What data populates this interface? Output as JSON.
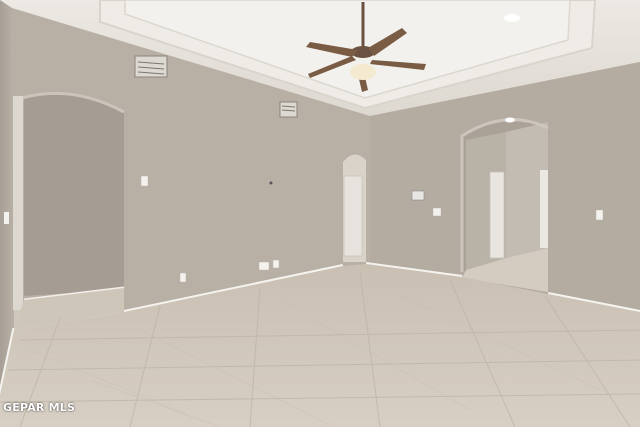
{
  "watermark": {
    "text": "GEPAR MLS"
  },
  "scene": {
    "type": "photo",
    "room": "empty-living-room",
    "colors": {
      "wall": "#b8b0a5",
      "ceiling": "#e6e2dc",
      "floor": "#d2c9bd",
      "trim": "#f5f3ef",
      "ceiling_fan": "#6b5240"
    }
  }
}
